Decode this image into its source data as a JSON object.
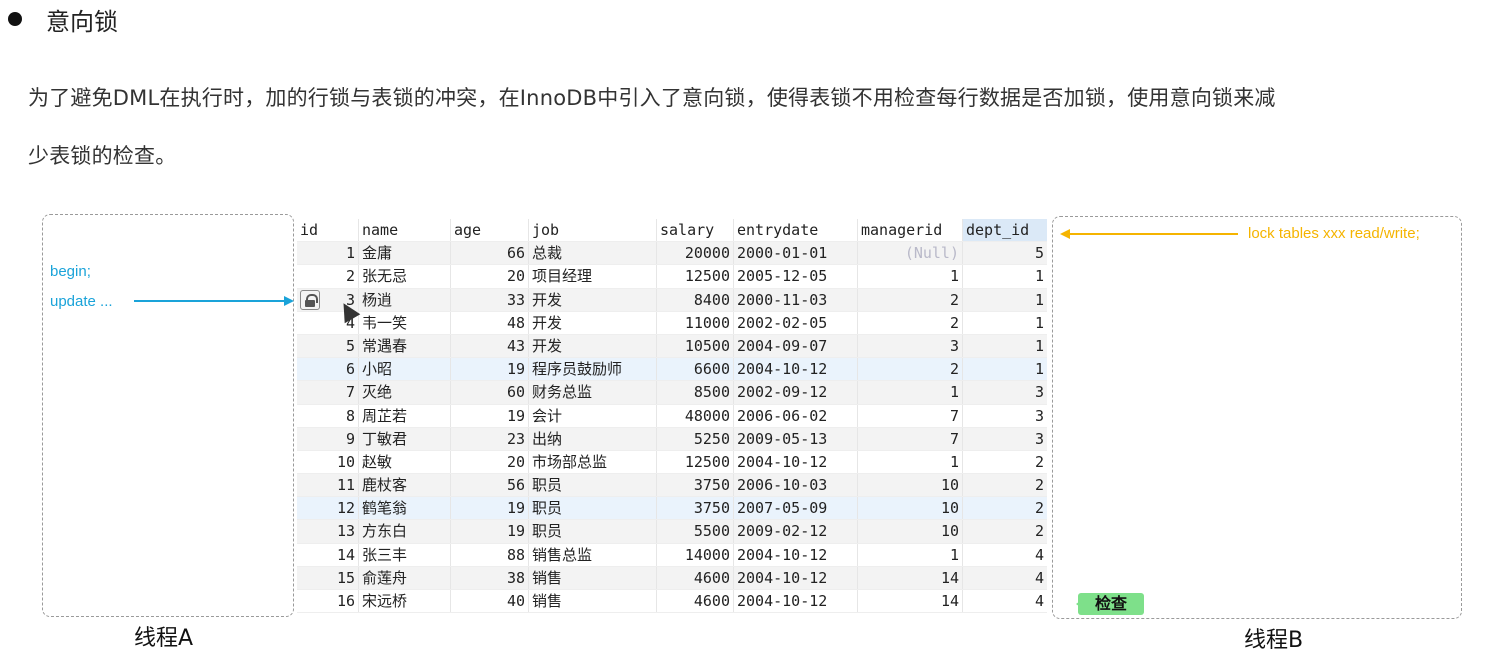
{
  "heading": {
    "text": "意向锁"
  },
  "paragraph": {
    "line1": "为了避免DML在执行时，加的行锁与表锁的冲突，在InnoDB中引入了意向锁，使得表锁不用检查每行数据是否加锁，使用意向锁来减",
    "line2": "少表锁的检查。"
  },
  "thread_a": {
    "label": "线程A",
    "begin": "begin;",
    "update": "update ..."
  },
  "thread_b": {
    "label": "线程B",
    "lock_statement": "lock tables xxx read/write;",
    "check_tag": "检查"
  },
  "colors": {
    "blue_annotation": "#1aa3d9",
    "yellow_annotation": "#f5b400",
    "green_tag": "#7ee08a"
  },
  "icons": {
    "row_lock": "lock-icon",
    "cursor": "mouse-cursor-icon"
  },
  "table": {
    "columns": [
      "id",
      "name",
      "age",
      "job",
      "salary",
      "entrydate",
      "managerid",
      "dept_id"
    ],
    "rows": [
      [
        "1",
        "金庸",
        "66",
        "总裁",
        "20000",
        "2000-01-01",
        "(Null)",
        "5"
      ],
      [
        "2",
        "张无忌",
        "20",
        "项目经理",
        "12500",
        "2005-12-05",
        "1",
        "1"
      ],
      [
        "3",
        "杨逍",
        "33",
        "开发",
        "8400",
        "2000-11-03",
        "2",
        "1"
      ],
      [
        "4",
        "韦一笑",
        "48",
        "开发",
        "11000",
        "2002-02-05",
        "2",
        "1"
      ],
      [
        "5",
        "常遇春",
        "43",
        "开发",
        "10500",
        "2004-09-07",
        "3",
        "1"
      ],
      [
        "6",
        "小昭",
        "19",
        "程序员鼓励师",
        "6600",
        "2004-10-12",
        "2",
        "1"
      ],
      [
        "7",
        "灭绝",
        "60",
        "财务总监",
        "8500",
        "2002-09-12",
        "1",
        "3"
      ],
      [
        "8",
        "周芷若",
        "19",
        "会计",
        "48000",
        "2006-06-02",
        "7",
        "3"
      ],
      [
        "9",
        "丁敏君",
        "23",
        "出纳",
        "5250",
        "2009-05-13",
        "7",
        "3"
      ],
      [
        "10",
        "赵敏",
        "20",
        "市场部总监",
        "12500",
        "2004-10-12",
        "1",
        "2"
      ],
      [
        "11",
        "鹿杖客",
        "56",
        "职员",
        "3750",
        "2006-10-03",
        "10",
        "2"
      ],
      [
        "12",
        "鹤笔翁",
        "19",
        "职员",
        "3750",
        "2007-05-09",
        "10",
        "2"
      ],
      [
        "13",
        "方东白",
        "19",
        "职员",
        "5500",
        "2009-02-12",
        "10",
        "2"
      ],
      [
        "14",
        "张三丰",
        "88",
        "销售总监",
        "14000",
        "2004-10-12",
        "1",
        "4"
      ],
      [
        "15",
        "俞莲舟",
        "38",
        "销售",
        "4600",
        "2004-10-12",
        "14",
        "4"
      ],
      [
        "16",
        "宋远桥",
        "40",
        "销售",
        "4600",
        "2004-10-12",
        "14",
        "4"
      ]
    ]
  }
}
